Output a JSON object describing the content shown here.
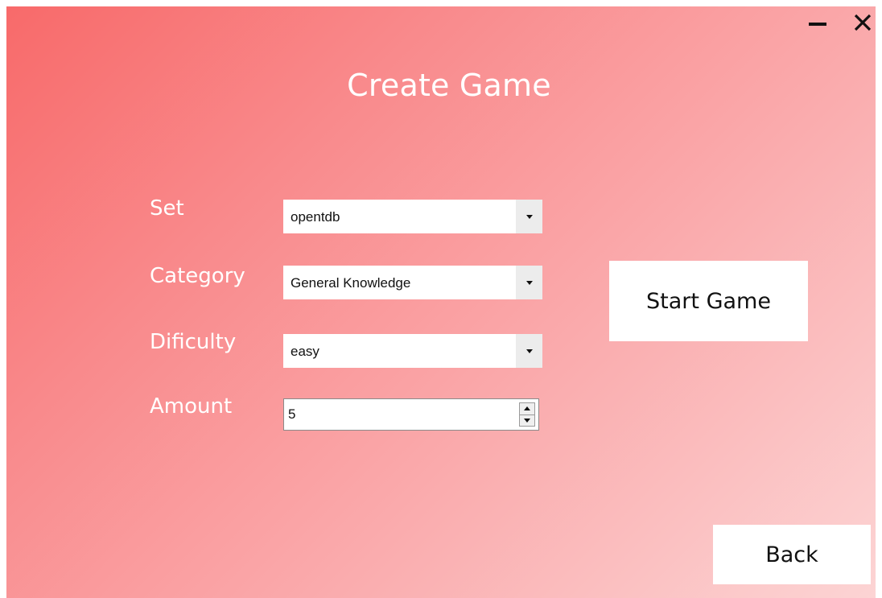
{
  "window": {
    "title": "Create Game",
    "controls": {
      "minimize_icon": "minimize-icon",
      "close_icon": "close-icon"
    },
    "background_gradient": [
      "#f86a6a",
      "#fcd4d4"
    ]
  },
  "form": {
    "set": {
      "label": "Set",
      "value": "opentdb"
    },
    "category": {
      "label": "Category",
      "value": "General Knowledge"
    },
    "difficulty": {
      "label": "Dificulty",
      "value": "easy"
    },
    "amount": {
      "label": "Amount",
      "value": "5"
    }
  },
  "buttons": {
    "start_label": "Start Game",
    "back_label": "Back"
  }
}
